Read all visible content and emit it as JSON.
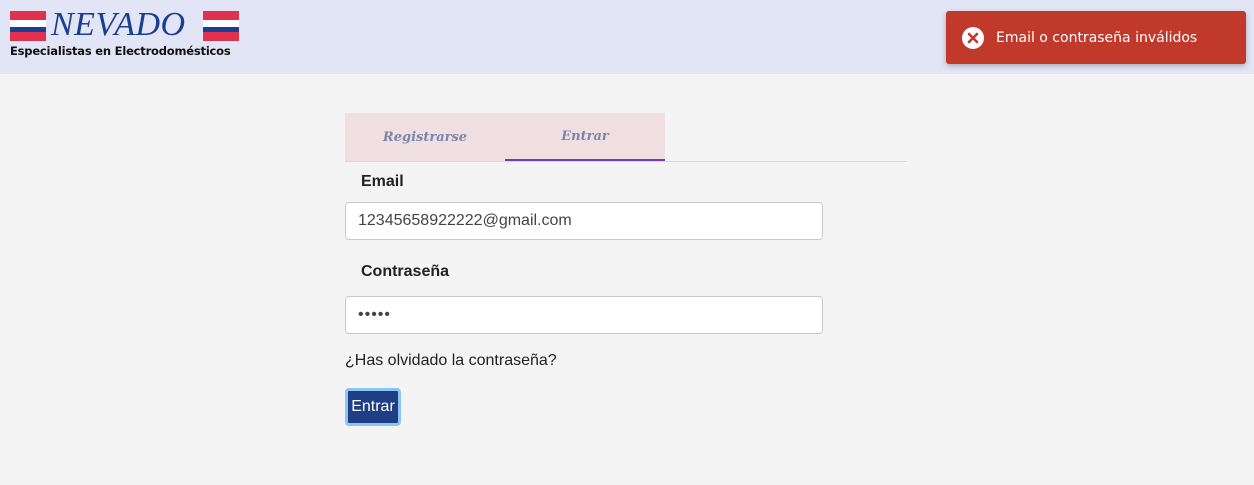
{
  "logo": {
    "word": "NEVADO",
    "tagline": "Especialistas en Electrodomésticos"
  },
  "toast": {
    "icon": "error-x-icon",
    "message": "Email o contraseña inválidos",
    "color": "#c0392b"
  },
  "tabs": [
    {
      "label": "Registrarse",
      "active": false
    },
    {
      "label": "Entrar",
      "active": true
    }
  ],
  "form": {
    "email_label": "Email",
    "email_value": "12345658922222@gmail.com",
    "password_label": "Contraseña",
    "password_value": "•••••",
    "forgot_link": "¿Has olvidado la contraseña?",
    "submit_label": "Entrar"
  },
  "colors": {
    "header_bg": "#e1e5f5",
    "page_bg": "#f4f4f4",
    "tab_bg": "#f0dfe0",
    "tab_active_underline": "#6b3fc6",
    "button_bg": "#1f3f84"
  }
}
